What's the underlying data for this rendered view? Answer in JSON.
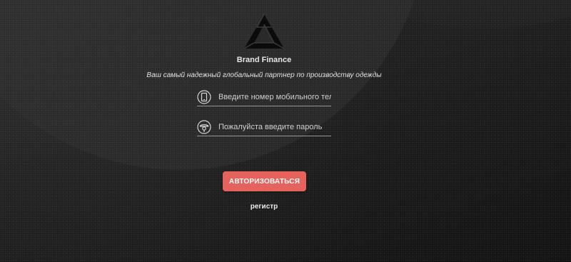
{
  "brand": {
    "name": "Brand Finance",
    "tagline": "Ваш самый надежный глобальный партнер по производству одежды",
    "logo_icon": "penrose-triangle-logo"
  },
  "login_form": {
    "phone_placeholder": "Введите номер мобильного телефона",
    "phone_icon": "phone-icon",
    "password_placeholder": "Пожалуйста введите пароль",
    "password_icon": "lock-icon",
    "submit_label": "АВТОРИЗОВАТЬСЯ",
    "register_label": "регистр"
  },
  "colors": {
    "accent": "#e5625d",
    "background": "#141414",
    "text": "#e6e6e6"
  }
}
